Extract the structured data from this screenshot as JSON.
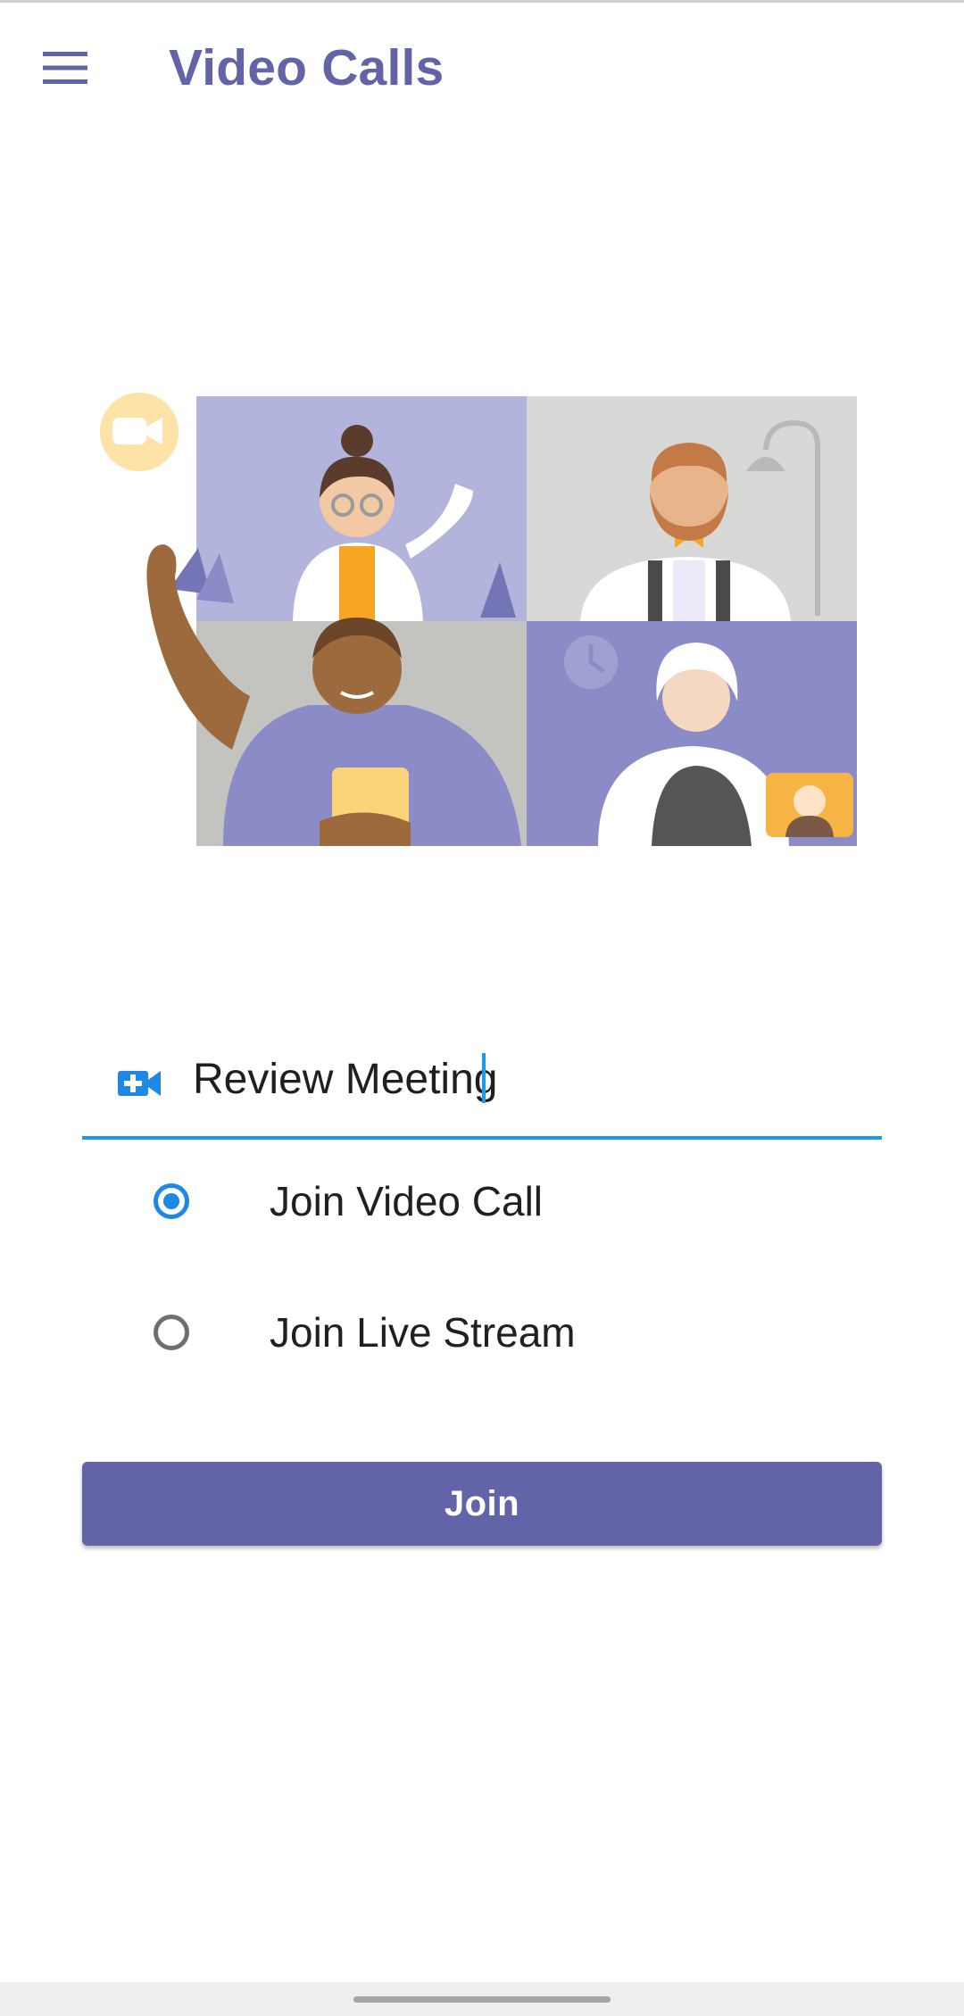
{
  "app": {
    "title": "Video Calls"
  },
  "header": {
    "menu_icon": "hamburger-menu-icon"
  },
  "illustration": {
    "description_icon": "video-call-group-illustration",
    "colors": {
      "lavender": "#b3b4dc",
      "purple": "#8b8cc7",
      "gray": "#d6d6d4",
      "orange": "#f6b444",
      "cream": "#fde3a7"
    }
  },
  "meeting": {
    "icon": "video-camera-add-icon",
    "value": "Review Meeting",
    "placeholder": ""
  },
  "options": [
    {
      "label": "Join Video Call",
      "selected": true
    },
    {
      "label": "Join Live Stream",
      "selected": false
    }
  ],
  "actions": {
    "join_label": "Join"
  },
  "colors": {
    "brand": "#6264a7",
    "accent": "#2196f3",
    "radio_selected": "#1e88e5"
  }
}
